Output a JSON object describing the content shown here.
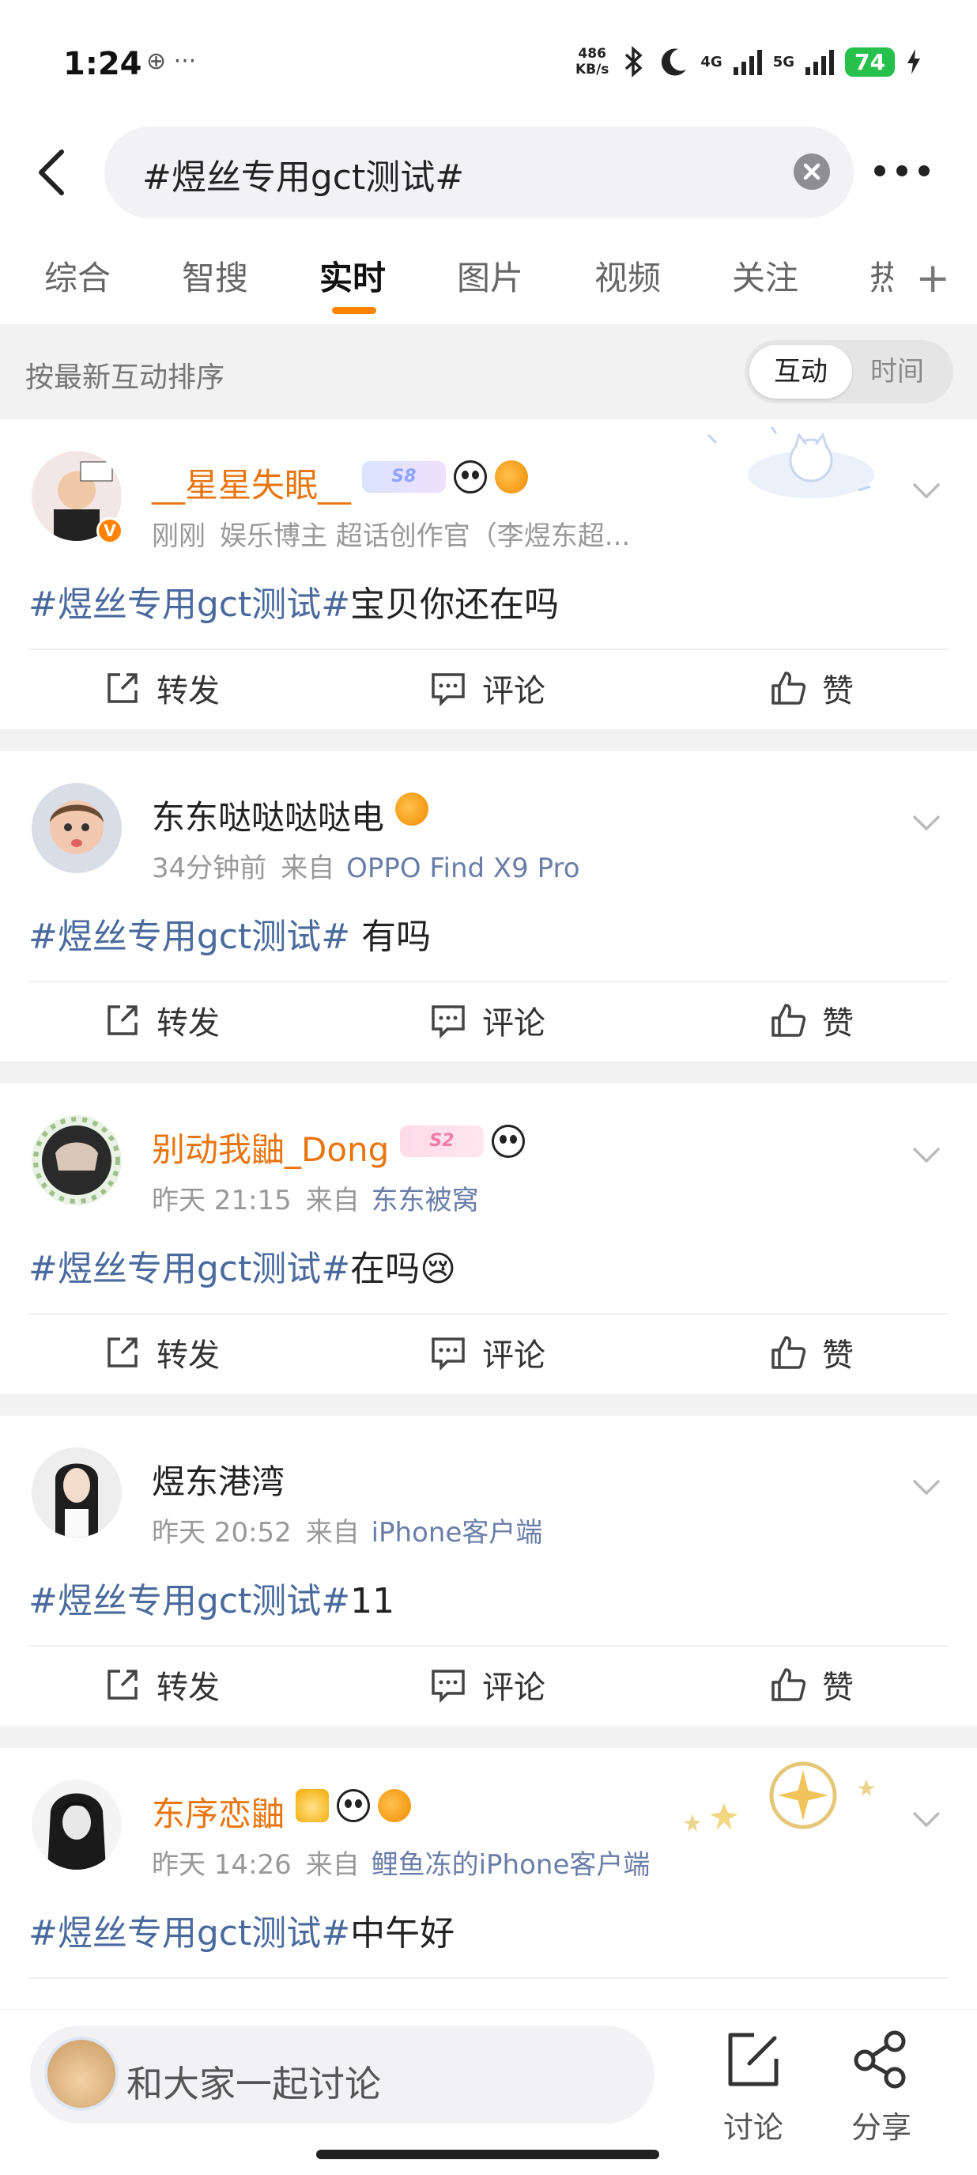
{
  "status": {
    "time": "1:24",
    "extra": "⊕ ···",
    "net_speed_value": "486",
    "net_speed_unit": "KB/s",
    "sig1": "4G",
    "sig2": "5G",
    "battery": "74"
  },
  "search": {
    "query": "#煜丝专用gct测试#"
  },
  "tabs": [
    "综合",
    "智搜",
    "实时",
    "图片",
    "视频",
    "关注",
    "热"
  ],
  "active_tab": "实时",
  "sort": {
    "label": "按最新互动排序",
    "option_active": "互动",
    "option_inactive": "时间"
  },
  "actions": {
    "repost": "转发",
    "comment": "评论",
    "like": "赞"
  },
  "posts": [
    {
      "name": "__星星失眠__",
      "level": "S8",
      "time": "刚刚",
      "source": "",
      "extra": "娱乐博主 超话创作官（李煜东超...",
      "topic": "#煜丝专用gct测试#",
      "text": "宝贝你还在吗"
    },
    {
      "name": "东东哒哒哒哒电",
      "time": "34分钟前",
      "source_prefix": "来自",
      "source": "OPPO Find X9 Pro",
      "topic": "#煜丝专用gct测试#",
      "text": " 有吗"
    },
    {
      "name": "别动我鼬_Dong",
      "level": "S2",
      "time": "昨天 21:15",
      "source_prefix": "来自",
      "source": "东东被窝",
      "topic": "#煜丝专用gct测试#",
      "text": "在吗😢"
    },
    {
      "name": "煜东港湾",
      "time": "昨天 20:52",
      "source_prefix": "来自",
      "source": "iPhone客户端",
      "topic": "#煜丝专用gct测试#",
      "text": "11"
    },
    {
      "name": "东序恋鼬",
      "time": "昨天 14:26",
      "source_prefix": "来自",
      "source": "鲤鱼冻的iPhone客户端",
      "topic": "#煜丝专用gct测试#",
      "text": "中午好"
    }
  ],
  "bottom": {
    "comment_placeholder": "和大家一起讨论",
    "discuss": "讨论",
    "share": "分享"
  },
  "colors": {
    "accent": "#ff8200",
    "topic": "#4a6a9e",
    "vip_name": "#e87510"
  }
}
